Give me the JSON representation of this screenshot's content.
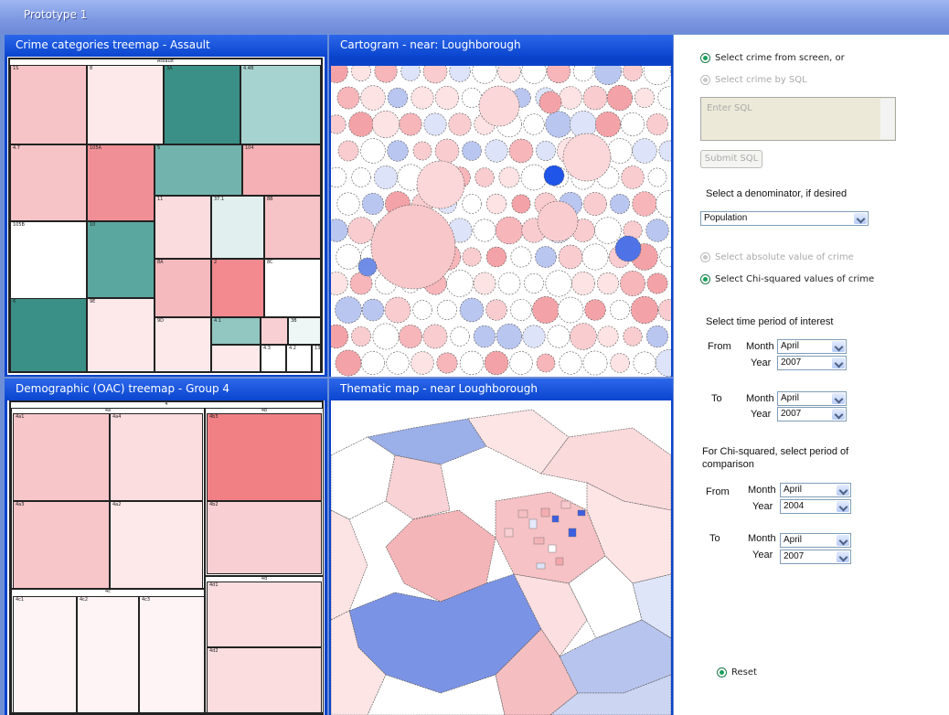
{
  "window": {
    "title": "Prototype 1"
  },
  "panels": {
    "crime_treemap": {
      "title": "Crime categories treemap - Assault",
      "root_label": "Assault"
    },
    "cartogram": {
      "title": "Cartogram - near: Loughborough"
    },
    "oac_treemap": {
      "title": "Demographic (OAC) treemap - Group 4",
      "root_label": "4"
    },
    "thematic_map": {
      "title": "Thematic map - near Loughborough"
    }
  },
  "crime_cells": [
    {
      "label": "1S",
      "color": "#f6c3c6"
    },
    {
      "label": "8",
      "color": "#fde9ea"
    },
    {
      "label": "3A",
      "color": "#3a8f86"
    },
    {
      "label": "4.4B",
      "color": "#a6d3cf"
    },
    {
      "label": "4.7",
      "color": "#f6c3c6"
    },
    {
      "label": "105A",
      "color": "#f08f95"
    },
    {
      "label": "5",
      "color": "#72b4ad"
    },
    {
      "label": "104",
      "color": "#f4b0b4"
    },
    {
      "label": "105B",
      "color": "#ffffff"
    },
    {
      "label": "10",
      "color": "#5aa79f"
    },
    {
      "label": "11",
      "color": "#fbdcde"
    },
    {
      "label": "37.1",
      "color": "#e1efee"
    },
    {
      "label": "8B",
      "color": "#f6c3c6"
    },
    {
      "label": "8A",
      "color": "#f5babd"
    },
    {
      "label": "2",
      "color": "#f28a8f"
    },
    {
      "label": "8C",
      "color": "#ffffff"
    },
    {
      "label": "6",
      "color": "#3a8f86"
    },
    {
      "label": "9E",
      "color": "#fde9ea"
    },
    {
      "label": "9D",
      "color": "#fde9ea"
    },
    {
      "label": "4.1",
      "color": "#92c6c0"
    },
    {
      "label": "",
      "color": "#f8cfd2"
    },
    {
      "label": "3B",
      "color": "#eef7f6"
    },
    {
      "label": "",
      "color": "#fde9ea"
    },
    {
      "label": "4.3",
      "color": "#ffffff"
    },
    {
      "label": "4.2",
      "color": "#ffffff"
    },
    {
      "label": "13",
      "color": "#ffffff"
    }
  ],
  "oac_groups": {
    "g_a": "4a",
    "g_b": "4b",
    "g_c": "4c",
    "g_d": "4d"
  },
  "oac_cells": [
    {
      "label": "4a1",
      "color": "#f7c6c9"
    },
    {
      "label": "4a4",
      "color": "#fbdde0"
    },
    {
      "label": "4b3",
      "color": "#f08084"
    },
    {
      "label": "4a3",
      "color": "#f7c6c9"
    },
    {
      "label": "4a2",
      "color": "#fde9ea"
    },
    {
      "label": "4b2",
      "color": "#f8cfd2"
    },
    {
      "label": "4c1",
      "color": "#fef4f5"
    },
    {
      "label": "4c2",
      "color": "#fef4f5"
    },
    {
      "label": "4c3",
      "color": "#fef4f5"
    },
    {
      "label": "4d1",
      "color": "#fbdde0"
    },
    {
      "label": "4d2",
      "color": "#fbdde0"
    }
  ],
  "controls": {
    "select_screen": "Select crime from screen, or",
    "select_sql": "Select crime by SQL",
    "sql_placeholder": "Enter SQL",
    "submit_sql": "Submit SQL",
    "denominator_label": "Select a denominator, if desired",
    "denominator_value": "Population",
    "abs_value": "Select absolute value of crime",
    "chi_value": "Select Chi-squared values of crime",
    "period_label": "Select time period of interest",
    "from": "From",
    "to": "To",
    "month": "Month",
    "year": "Year",
    "from_month": "April",
    "from_year": "2007",
    "to_month": "April",
    "to_year": "2007",
    "chi_period_label": "For Chi-squared, select period of comparison",
    "chi_from_month": "April",
    "chi_from_year": "2004",
    "chi_to_month": "April",
    "chi_to_year": "2007",
    "reset": "Reset"
  }
}
